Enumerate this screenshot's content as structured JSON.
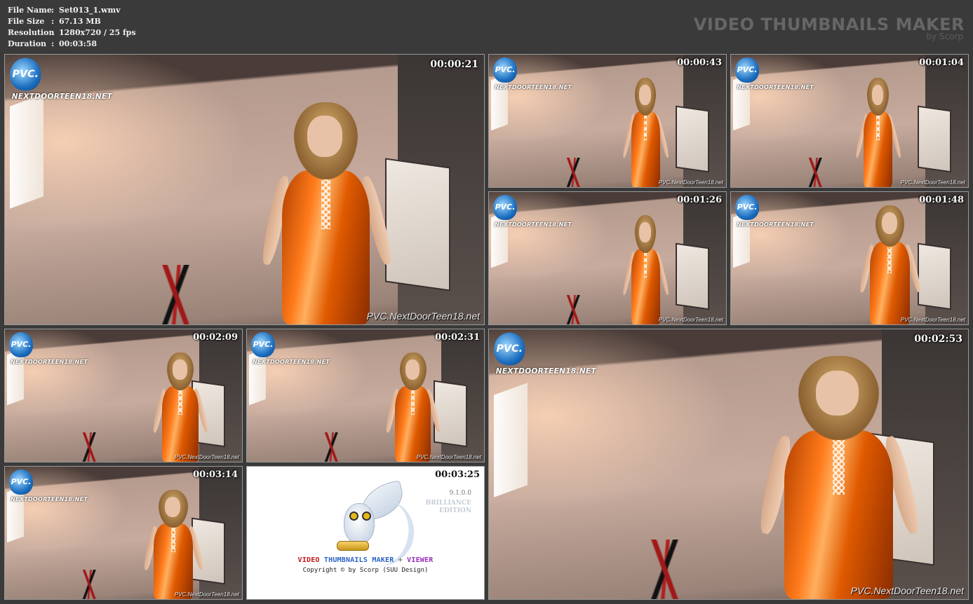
{
  "file_info": {
    "file_name": {
      "key": "File Name",
      "value": "Set013_1.wmv"
    },
    "file_size": {
      "key": "File Size",
      "value": "67.13 MB"
    },
    "resolution": {
      "key": "Resolution",
      "value": "1280x720 / 25 fps"
    },
    "duration": {
      "key": "Duration",
      "value": "00:03:58"
    }
  },
  "brand": {
    "title": "VIDEO THUMBNAILS MAKER",
    "subtitle": "by Scorp"
  },
  "logo": {
    "mark": "PVC.",
    "site": "NEXTDOORTEEN18.NET"
  },
  "watermark": "PVC.NextDoorTeen18.net",
  "thumbnails": [
    {
      "time": "00:00:21"
    },
    {
      "time": "00:00:43"
    },
    {
      "time": "00:01:04"
    },
    {
      "time": "00:01:26"
    },
    {
      "time": "00:01:48"
    },
    {
      "time": "00:02:09"
    },
    {
      "time": "00:02:31"
    },
    {
      "time": "00:02:53"
    },
    {
      "time": "00:03:14"
    },
    {
      "time": "00:03:25"
    }
  ],
  "splash": {
    "version": "9.1.0.0",
    "edition": "BRILLIANCE\nEDITION",
    "product_part1": "VIDEO",
    "product_part2": "THUMBNAILS MAKER",
    "product_part3": "+",
    "product_part4": "VIEWER",
    "copyright": "Copyright © by Scorp (SUU Design)"
  },
  "colors": {
    "page_background": "#3a3a3a",
    "dress_orange": "#ff7a1a",
    "brand_text": "#666666"
  }
}
